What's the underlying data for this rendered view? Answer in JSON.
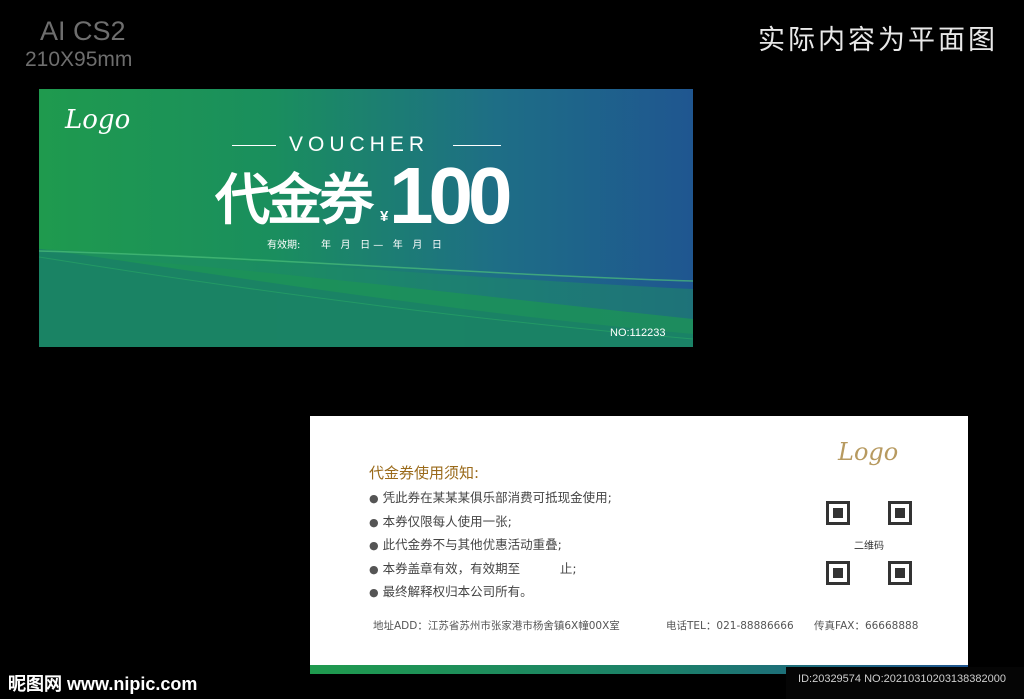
{
  "meta": {
    "format": "AI CS2",
    "size": "210X95mm",
    "note": "实际内容为平面图"
  },
  "front": {
    "logo": "Logo",
    "title_en": "VOUCHER",
    "title_cn": "代金券",
    "currency": "¥",
    "amount": "100",
    "validity_label": "有效期:",
    "validity_dates": "年   月   日 —   年   月   日",
    "serial": "NO:112233",
    "colors": {
      "gradient_start": "#1f9a4e",
      "gradient_end": "#1f5690"
    }
  },
  "back": {
    "logo": "Logo",
    "rules_title": "代金券使用须知:",
    "rules": [
      "凭此券在某某某俱乐部消费可抵现金使用;",
      "本券仅限每人使用一张;",
      "此代金券不与其他优惠活动重叠;",
      "本券盖章有效，有效期至          止;",
      "最终解释权归本公司所有。"
    ],
    "qr_label": "二维码",
    "address": "地址ADD：江苏省苏州市张家港市杨舍镇6X幢00X室",
    "tel": "电话TEL：021-88886666",
    "fax": "传真FAX：66668888"
  },
  "watermark": {
    "brand": "昵图网 www.nipic.com",
    "id": "ID:20329574 NO:20210310203138382000"
  }
}
